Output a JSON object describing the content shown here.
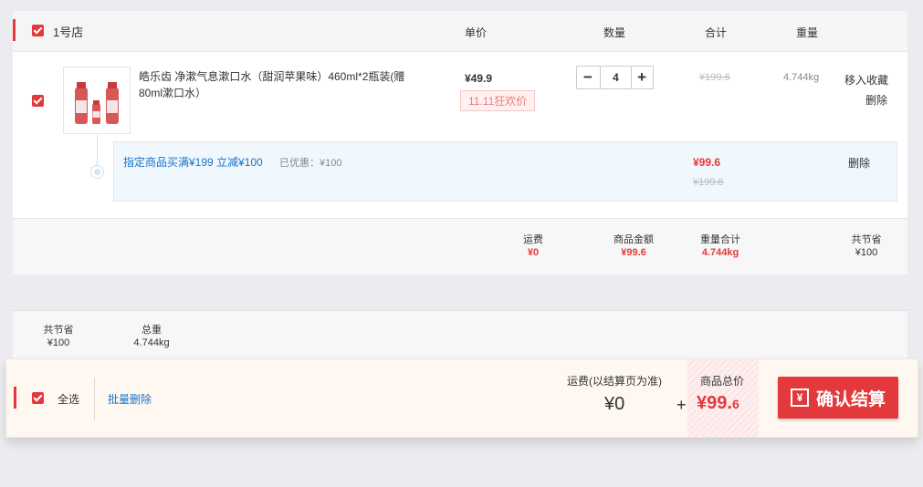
{
  "store": {
    "name": "1号店"
  },
  "columns": {
    "price": "单价",
    "qty": "数量",
    "subtotal": "合计",
    "weight": "重量"
  },
  "item": {
    "title_line1": "皓乐齿 净漱气息漱口水（甜润苹果味）460ml*2瓶装(赠",
    "title_line2": "80ml漱口水）",
    "price": "¥49.9",
    "promo_tag": "11.11狂欢价",
    "quantity": "4",
    "qty_minus": "−",
    "qty_plus": "+",
    "subtotal_orig": "¥199.6",
    "weight": "4.744kg",
    "action_fav": "移入收藏",
    "action_delete": "删除"
  },
  "promo": {
    "text": "指定商品买满¥199 立减¥100",
    "saved_label": "已优惠：¥100",
    "price_after": "¥99.6",
    "price_before": "¥199.6",
    "delete": "删除"
  },
  "store_summary": {
    "shipping_label": "运费",
    "shipping_value": "¥0",
    "goods_label": "商品金额",
    "goods_value": "¥99.6",
    "weight_label": "重量合计",
    "weight_value": "4.744kg",
    "saved_label": "共节省",
    "saved_value": "¥100"
  },
  "totals": {
    "saved_label": "共节省",
    "saved_value": "¥100",
    "weight_label": "总重",
    "weight_value": "4.744kg"
  },
  "footer": {
    "select_all": "全选",
    "batch_delete": "批量删除",
    "shipping_label": "运费(以结算页为准)",
    "shipping_value": "¥0",
    "plus": "+",
    "total_label": "商品总价",
    "total_value_main": "¥99.",
    "total_value_dec": "6",
    "checkout": "确认结算",
    "yen_icon": "¥"
  },
  "colors": {
    "accent": "#e4393c",
    "link": "#1a73c8"
  }
}
